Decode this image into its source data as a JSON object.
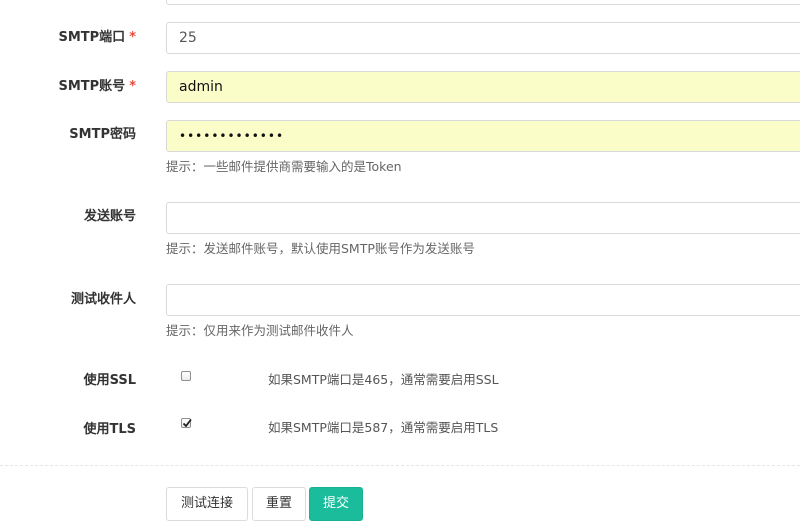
{
  "form": {
    "top_field": {
      "value": ""
    },
    "smtp_port": {
      "label": "SMTP端口",
      "required_mark": "*",
      "value": "25"
    },
    "smtp_account": {
      "label": "SMTP账号",
      "required_mark": "*",
      "value": "admin"
    },
    "smtp_password": {
      "label": "SMTP密码",
      "value": "•••••••••••••",
      "hint": "提示：一些邮件提供商需要输入的是Token"
    },
    "sender_account": {
      "label": "发送账号",
      "value": "",
      "hint": "提示：发送邮件账号，默认使用SMTP账号作为发送账号"
    },
    "test_recipient": {
      "label": "测试收件人",
      "value": "",
      "hint": "提示：仅用来作为测试邮件收件人"
    },
    "use_ssl": {
      "label": "使用SSL",
      "checked": false,
      "note": "如果SMTP端口是465，通常需要启用SSL"
    },
    "use_tls": {
      "label": "使用TLS",
      "checked": true,
      "note": "如果SMTP端口是587，通常需要启用TLS"
    }
  },
  "actions": {
    "test_connection": "测试连接",
    "reset": "重置",
    "submit": "提交"
  },
  "colors": {
    "required": "#e74c3c",
    "autofill_background": "#fafdc8",
    "primary_button": "#1abc9c"
  }
}
